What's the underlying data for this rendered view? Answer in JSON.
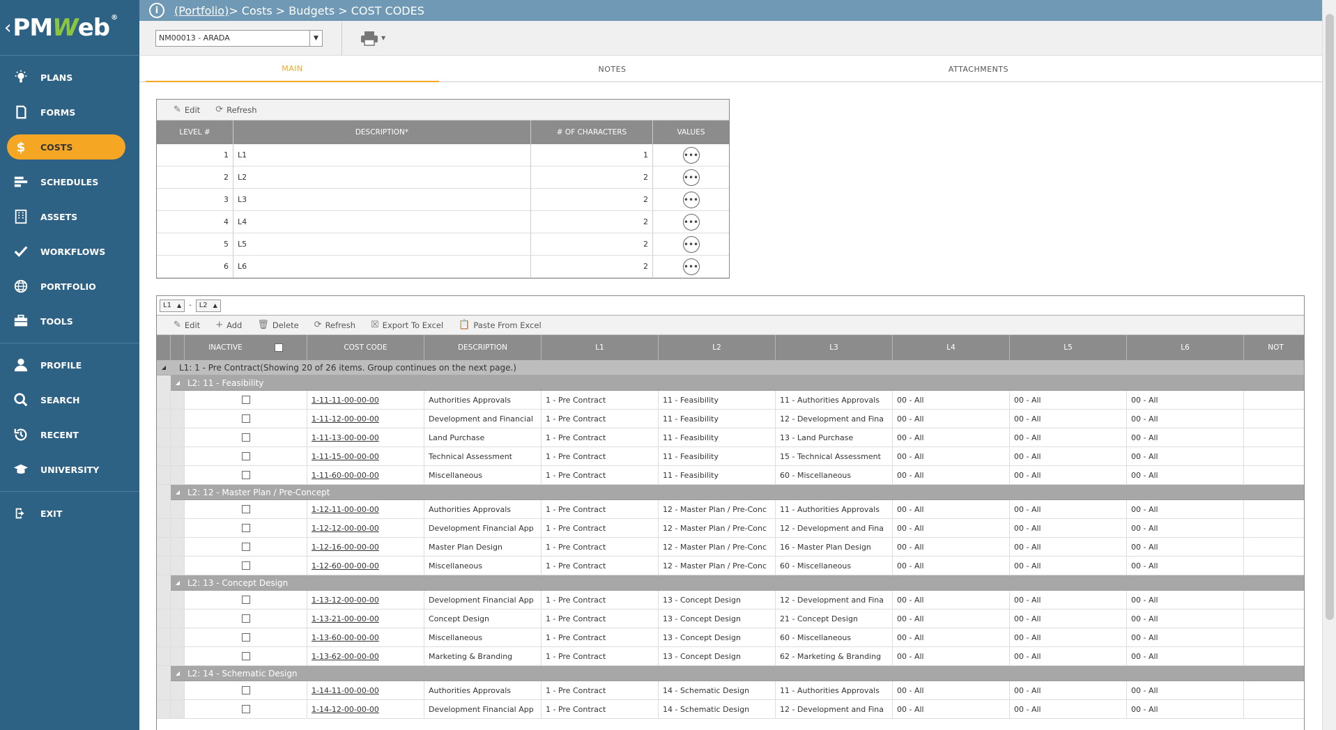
{
  "sidebar": {
    "logo_pre": "PM",
    "logo_w": "W",
    "logo_post": "eb",
    "logo_reg": "®",
    "items": [
      {
        "label": "PLANS",
        "icon": "lightbulb-icon"
      },
      {
        "label": "FORMS",
        "icon": "forms-icon"
      },
      {
        "label": "COSTS",
        "icon": "dollar-icon",
        "active": true
      },
      {
        "label": "SCHEDULES",
        "icon": "schedule-icon"
      },
      {
        "label": "ASSETS",
        "icon": "building-icon"
      },
      {
        "label": "WORKFLOWS",
        "icon": "checkmark-icon"
      },
      {
        "label": "PORTFOLIO",
        "icon": "globe-icon"
      },
      {
        "label": "TOOLS",
        "icon": "toolbox-icon"
      }
    ],
    "items2": [
      {
        "label": "PROFILE",
        "icon": "user-icon"
      },
      {
        "label": "SEARCH",
        "icon": "search-icon"
      },
      {
        "label": "RECENT",
        "icon": "history-icon"
      },
      {
        "label": "UNIVERSITY",
        "icon": "graduation-cap-icon"
      }
    ],
    "exit_label": "EXIT"
  },
  "header": {
    "breadcrumb_link": "(Portfolio)",
    "breadcrumb_rest": " > Costs > Budgets > COST CODES"
  },
  "toolbar": {
    "project_value": "NM00013 - ARADA"
  },
  "tabs": [
    {
      "label": "MAIN",
      "active": true
    },
    {
      "label": "NOTES"
    },
    {
      "label": "ATTACHMENTS"
    }
  ],
  "levels_grid": {
    "edit_label": "Edit",
    "refresh_label": "Refresh",
    "headers": [
      "LEVEL #",
      "DESCRIPTION*",
      "# OF CHARACTERS",
      "VALUES"
    ],
    "rows": [
      {
        "level": "1",
        "desc": "L1",
        "chars": "1"
      },
      {
        "level": "2",
        "desc": "L2",
        "chars": "2"
      },
      {
        "level": "3",
        "desc": "L3",
        "chars": "2"
      },
      {
        "level": "4",
        "desc": "L4",
        "chars": "2"
      },
      {
        "level": "5",
        "desc": "L5",
        "chars": "2"
      },
      {
        "level": "6",
        "desc": "L6",
        "chars": "2"
      }
    ]
  },
  "codes_grid": {
    "group_chips": [
      "L1",
      "L2"
    ],
    "toolbar": {
      "edit": "Edit",
      "add": "Add",
      "delete": "Delete",
      "refresh": "Refresh",
      "export": "Export To Excel",
      "paste": "Paste From Excel"
    },
    "headers": {
      "inactive": "INACTIVE",
      "code": "COST CODE",
      "desc": "DESCRIPTION",
      "l1": "L1",
      "l2": "L2",
      "l3": "L3",
      "l4": "L4",
      "l5": "L5",
      "l6": "L6",
      "not": "NOT"
    },
    "l1_group": "L1: 1 - Pre Contract(Showing 20 of 26 items. Group continues on the next page.)",
    "groups": [
      {
        "label": "L2: 11 - Feasibility",
        "rows": [
          {
            "code": "1-11-11-00-00-00",
            "desc": "Authorities Approvals",
            "l1": "1 - Pre Contract",
            "l2": "11 - Feasibility",
            "l3": "11 - Authorities Approvals",
            "l4": "00 - All",
            "l5": "00 - All",
            "l6": "00 - All"
          },
          {
            "code": "1-11-12-00-00-00",
            "desc": "Development and Financial",
            "l1": "1 - Pre Contract",
            "l2": "11 - Feasibility",
            "l3": "12 - Development and Fina",
            "l4": "00 - All",
            "l5": "00 - All",
            "l6": "00 - All"
          },
          {
            "code": "1-11-13-00-00-00",
            "desc": "Land Purchase",
            "l1": "1 - Pre Contract",
            "l2": "11 - Feasibility",
            "l3": "13 - Land Purchase",
            "l4": "00 - All",
            "l5": "00 - All",
            "l6": "00 - All"
          },
          {
            "code": "1-11-15-00-00-00",
            "desc": "Technical Assessment",
            "l1": "1 - Pre Contract",
            "l2": "11 - Feasibility",
            "l3": "15 - Technical Assessment",
            "l4": "00 - All",
            "l5": "00 - All",
            "l6": "00 - All"
          },
          {
            "code": "1-11-60-00-00-00",
            "desc": "Miscellaneous",
            "l1": "1 - Pre Contract",
            "l2": "11 - Feasibility",
            "l3": "60 - Miscellaneous",
            "l4": "00 - All",
            "l5": "00 - All",
            "l6": "00 - All"
          }
        ]
      },
      {
        "label": "L2: 12 - Master Plan / Pre-Concept",
        "rows": [
          {
            "code": "1-12-11-00-00-00",
            "desc": "Authorities Approvals",
            "l1": "1 - Pre Contract",
            "l2": "12 - Master Plan / Pre-Conc",
            "l3": "11 - Authorities Approvals",
            "l4": "00 - All",
            "l5": "00 - All",
            "l6": "00 - All"
          },
          {
            "code": "1-12-12-00-00-00",
            "desc": "Development Financial App",
            "l1": "1 - Pre Contract",
            "l2": "12 - Master Plan / Pre-Conc",
            "l3": "12 - Development and Fina",
            "l4": "00 - All",
            "l5": "00 - All",
            "l6": "00 - All"
          },
          {
            "code": "1-12-16-00-00-00",
            "desc": "Master Plan Design",
            "l1": "1 - Pre Contract",
            "l2": "12 - Master Plan / Pre-Conc",
            "l3": "16 - Master Plan Design",
            "l4": "00 - All",
            "l5": "00 - All",
            "l6": "00 - All"
          },
          {
            "code": "1-12-60-00-00-00",
            "desc": "Miscellaneous",
            "l1": "1 - Pre Contract",
            "l2": "12 - Master Plan / Pre-Conc",
            "l3": "60 - Miscellaneous",
            "l4": "00 - All",
            "l5": "00 - All",
            "l6": "00 - All"
          }
        ]
      },
      {
        "label": "L2: 13 - Concept Design",
        "rows": [
          {
            "code": "1-13-12-00-00-00",
            "desc": "Development Financial App",
            "l1": "1 - Pre Contract",
            "l2": "13 - Concept Design",
            "l3": "12 - Development and Fina",
            "l4": "00 - All",
            "l5": "00 - All",
            "l6": "00 - All"
          },
          {
            "code": "1-13-21-00-00-00",
            "desc": "Concept Design",
            "l1": "1 - Pre Contract",
            "l2": "13 - Concept Design",
            "l3": "21 - Concept Design",
            "l4": "00 - All",
            "l5": "00 - All",
            "l6": "00 - All"
          },
          {
            "code": "1-13-60-00-00-00",
            "desc": "Miscellaneous",
            "l1": "1 - Pre Contract",
            "l2": "13 - Concept Design",
            "l3": "60 - Miscellaneous",
            "l4": "00 - All",
            "l5": "00 - All",
            "l6": "00 - All"
          },
          {
            "code": "1-13-62-00-00-00",
            "desc": "Marketing & Branding",
            "l1": "1 - Pre Contract",
            "l2": "13 - Concept Design",
            "l3": "62 - Marketing & Branding",
            "l4": "00 - All",
            "l5": "00 - All",
            "l6": "00 - All"
          }
        ]
      },
      {
        "label": "L2: 14 - Schematic Design",
        "rows": [
          {
            "code": "1-14-11-00-00-00",
            "desc": "Authorities Approvals",
            "l1": "1 - Pre Contract",
            "l2": "14 - Schematic Design",
            "l3": "11 - Authorities Approvals",
            "l4": "00 - All",
            "l5": "00 - All",
            "l6": "00 - All"
          },
          {
            "code": "1-14-12-00-00-00",
            "desc": "Development Financial App",
            "l1": "1 - Pre Contract",
            "l2": "14 - Schematic Design",
            "l3": "12 - Development and Fina",
            "l4": "00 - All",
            "l5": "00 - All",
            "l6": "00 - All"
          }
        ]
      }
    ]
  }
}
